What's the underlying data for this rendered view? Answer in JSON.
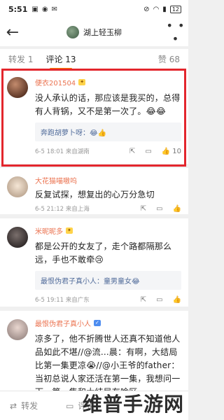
{
  "status": {
    "time": "5:51",
    "battery": "12"
  },
  "header": {
    "title": "湖上轻玉柳"
  },
  "tabs": {
    "repost": "转发 1",
    "comments": "评论 13",
    "likes": "赞 68"
  },
  "comments": [
    {
      "username": "便衣201504",
      "text": "没人承认的话，那应该是我买的，总得有人背锅，又不是第一次了。😂😂",
      "reply": "奔跑胡萝卜呀：😂👍",
      "meta": "6-5 18:01  来自湖南",
      "likes": "10"
    },
    {
      "username": "大花猫喵嗷呜",
      "text": "反复试探，想复出的心万分急切",
      "meta": "6-5 21:12  来自上海"
    },
    {
      "username": "米昵昵多",
      "text": "都是公开的女友了，走个路都隔那么远，手也不敢牵😢",
      "reply": "最恨伪君子真小人：童男童女😂",
      "meta": "6-5 19:11  来自广东"
    },
    {
      "username": "最恨伪君子真小人",
      "text": "凉多了，他不折腾世人还真不知道他人品如此不堪//@流...晨：有啊，大结局比第一集更凉😭//@小王爷的father：当初总说人家还活在第一集，我想问一下，第一集和大结局有啥区"
    }
  ],
  "bottom": {
    "repost": "转发",
    "comment": "评论"
  },
  "watermark": "维普手游网"
}
